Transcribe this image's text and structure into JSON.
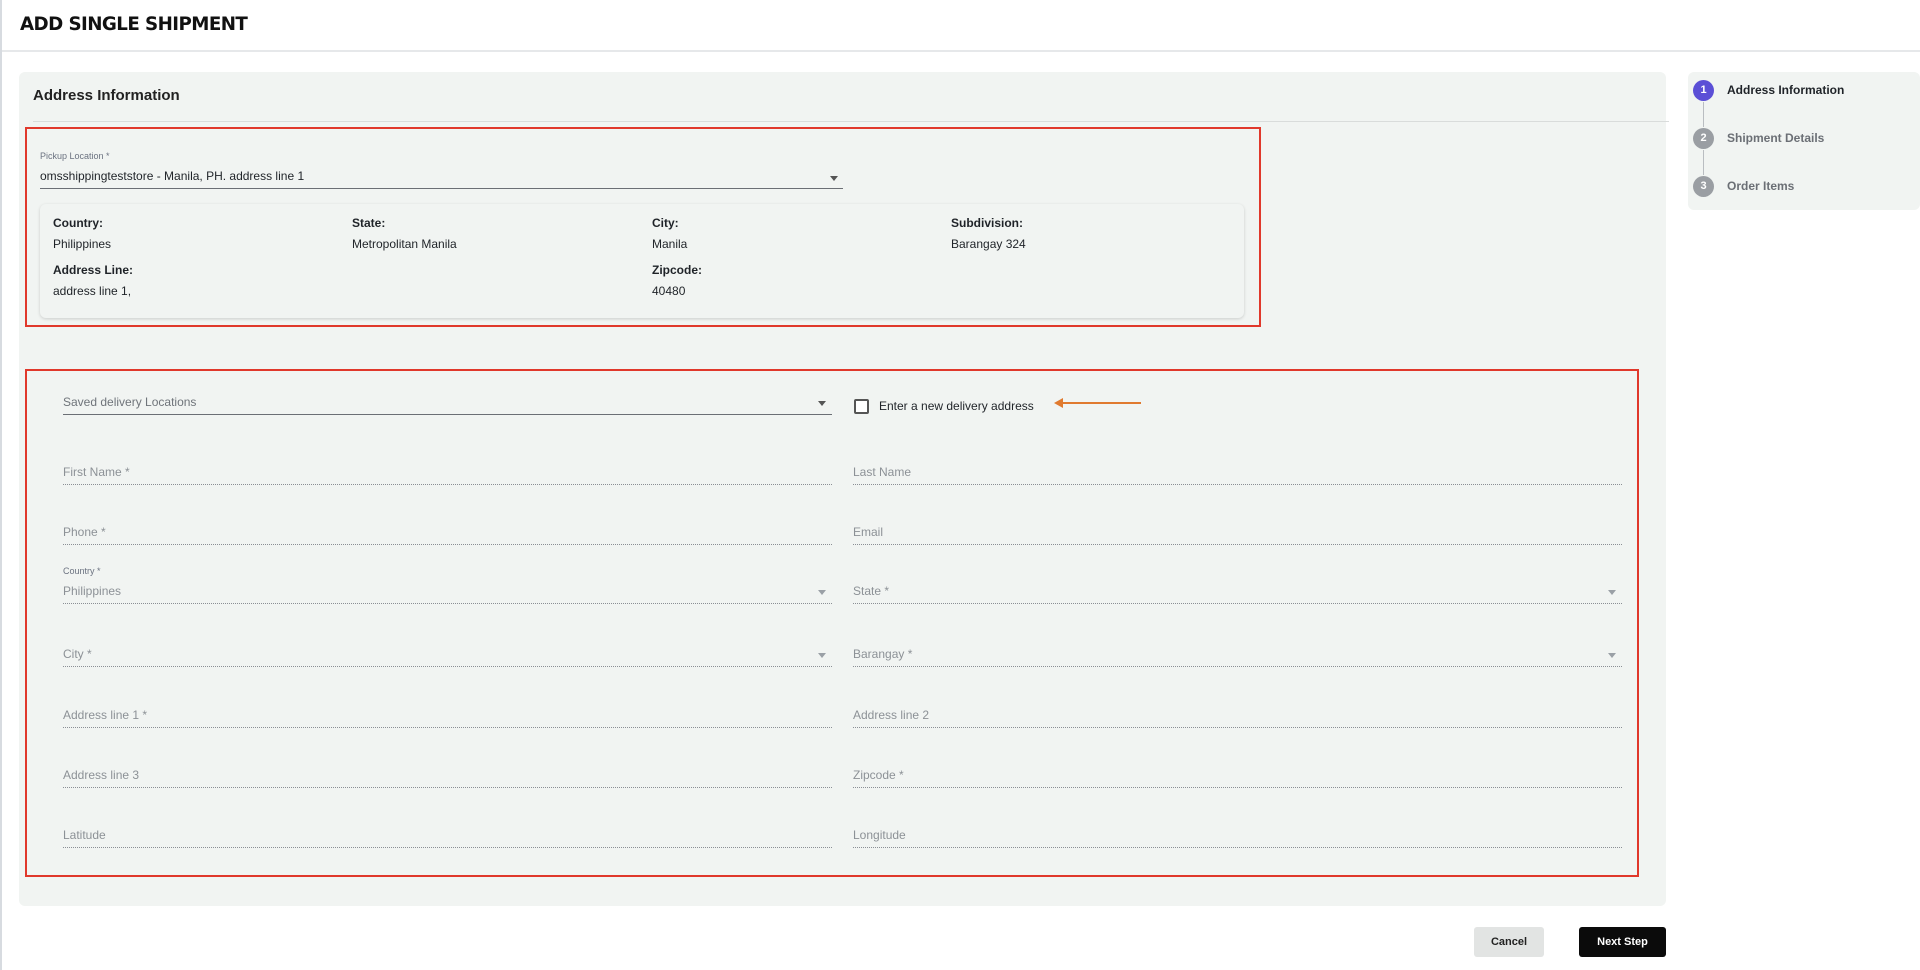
{
  "page": {
    "title": "ADD SINGLE SHIPMENT"
  },
  "section": {
    "title": "Address Information"
  },
  "pickup": {
    "label": "Pickup Location *",
    "value": "omsshippingteststore - Manila, PH. address line 1",
    "details": {
      "country_label": "Country:",
      "country": "Philippines",
      "state_label": "State:",
      "state": "Metropolitan Manila",
      "city_label": "City:",
      "city": "Manila",
      "subdivision_label": "Subdivision:",
      "subdivision": "Barangay 324",
      "address_label": "Address Line:",
      "address": "address line 1,",
      "zipcode_label": "Zipcode:",
      "zipcode": "40480"
    }
  },
  "delivery": {
    "saved_locations_placeholder": "Saved delivery Locations",
    "new_address_checkbox_label": "Enter a new delivery address",
    "new_address_checked": false,
    "fields": {
      "first_name": "First Name *",
      "last_name": "Last Name",
      "phone": "Phone *",
      "email": "Email",
      "country_label": "Country *",
      "country_value": "Philippines",
      "state": "State *",
      "city": "City *",
      "barangay": "Barangay *",
      "address_line_1": "Address line 1 *",
      "address_line_2": "Address line 2",
      "address_line_3": "Address line 3",
      "zipcode": "Zipcode *",
      "latitude": "Latitude",
      "longitude": "Longitude"
    }
  },
  "actions": {
    "cancel": "Cancel",
    "next": "Next Step"
  },
  "steps": [
    {
      "number": "1",
      "label": "Address Information",
      "state": "active"
    },
    {
      "number": "2",
      "label": "Shipment Details",
      "state": "inactive"
    },
    {
      "number": "3",
      "label": "Order Items",
      "state": "inactive"
    }
  ],
  "colors": {
    "accent": "#5b4fd6",
    "highlight_border": "#e0382b",
    "annotation_arrow": "#e07a2f",
    "panel_bg": "#f1f4f2",
    "primary_button": "#0b0b0b"
  }
}
